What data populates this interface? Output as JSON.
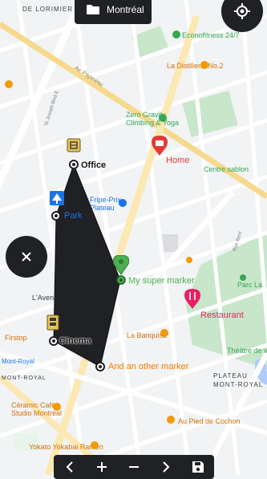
{
  "city_button": {
    "label": "Montréal",
    "icon": "folder-icon"
  },
  "map_labels": {
    "de_lorimier": "DE LORIMIER",
    "econofitness": "Econofitness 24/7",
    "la_distillerie": "La Distillerie No.2",
    "zero_gravity_1": "Zero Gravity",
    "zero_gravity_2": "Climbing & Yoga",
    "fripe_prix_1": "Fripe-Prix",
    "fripe_prix_2": "Plateau",
    "centre_sablon": "Centre sablon",
    "rue_rachel": "Rue Rachel E",
    "parc": "Parc La",
    "la_banquise": "La Banquise",
    "theatre": "Théâtre de ver",
    "plateau_1": "PLATEAU",
    "plateau_2": "MONT-ROYAL",
    "firstop": "Firstop",
    "mont_royal_1": "Mont-Royal",
    "mont_royal_2": "MONT-ROYAL",
    "ceramic_1": "Céramic Café",
    "ceramic_2": "Studio Montréal",
    "pied_cochon": "Au Pied de Cochon",
    "yokato": "Yokato Yokabai Ramen",
    "lavenue": "L'Avenue",
    "st_joseph": "St Joseph Blvd E",
    "papineau": "Av. Papineau",
    "berri": "Rue Berri"
  },
  "markers": {
    "office": "Office",
    "home": "Home",
    "park": "Park",
    "my_super_marker": "My super marker",
    "cinema": "Cinema",
    "another_marker": "And an other marker",
    "restaurant": "Restaurant"
  },
  "colors": {
    "accent_dark": "#202124",
    "polygon_fill": "#202124",
    "home_red": "#e53935",
    "marker_green": "#4caf50",
    "marker_orange": "#f57c00",
    "restaurant_pink": "#e91e63",
    "park_green": "#c8e6c9"
  },
  "toolbar": {
    "prev_icon": "chevron-left-icon",
    "zoom_in_icon": "plus-icon",
    "zoom_out_icon": "minus-icon",
    "next_icon": "chevron-right-icon",
    "save_icon": "save-icon"
  }
}
